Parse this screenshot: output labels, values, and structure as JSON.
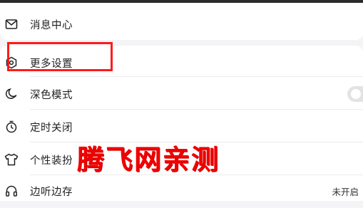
{
  "menu": {
    "message_center": {
      "label": "消息中心",
      "icon": "mail-icon"
    },
    "more_settings": {
      "label": "更多设置",
      "icon": "settings-icon"
    },
    "dark_mode": {
      "label": "深色模式",
      "icon": "moon-icon",
      "toggle_on": false
    },
    "timer_off": {
      "label": "定时关闭",
      "icon": "timer-icon"
    },
    "personalize": {
      "label": "个性装扮",
      "icon": "tshirt-icon"
    },
    "listen_while_save": {
      "label": "边听边存",
      "icon": "headphones-icon",
      "status": "未开启"
    }
  },
  "overlay": {
    "watermark": "腾飞网亲测",
    "highlight_color": "#ff1a1a"
  }
}
